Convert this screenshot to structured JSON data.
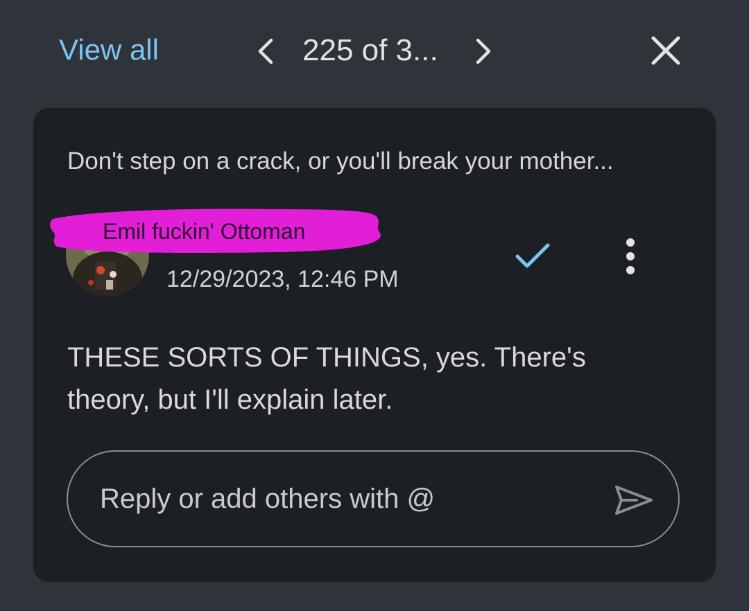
{
  "header": {
    "view_all_label": "View all",
    "counter_text": "225 of 3..."
  },
  "comment": {
    "quoted_text": "Don't step on a crack, or you'll break your mother...",
    "author": "Emil fuckin' Ottoman",
    "timestamp": "12/29/2023, 12:46 PM",
    "body": "THESE SORTS OF THINGS, yes. There's theory, but I'll explain later."
  },
  "reply": {
    "placeholder": "Reply or add others with @"
  },
  "icons": {
    "prev": "chevron-left-icon",
    "next": "chevron-right-icon",
    "close": "close-icon",
    "resolve": "check-icon",
    "more": "more-vert-icon",
    "send": "send-icon"
  },
  "colors": {
    "background": "#2f333a",
    "card": "#1c1f23",
    "link": "#7cc4f5",
    "redaction": "#e21fd6"
  }
}
